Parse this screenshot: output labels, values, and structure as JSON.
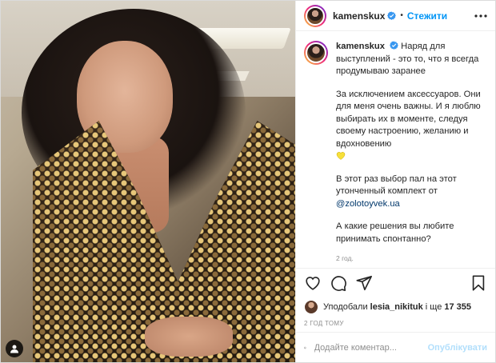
{
  "header": {
    "username": "kamenskux",
    "separator": "•",
    "follow_label": "Стежити"
  },
  "caption": {
    "username": "kamenskux",
    "p1": "Наряд для выступлений - это то, что я всегда продумываю заранее",
    "p2": "За исключением аксессуаров. Они для меня очень важны. И я люблю выбирать их в моменте, следуя своему настроению, желанию и вдохновению",
    "p3_before": "В этот раз выбор пал на этот утонченный комплект от",
    "p3_mention": "@zolotoyvek.ua",
    "p4": "А какие решения вы любите принимать спонтанно?",
    "time_ago": "2 год."
  },
  "likes": {
    "prefix": "Уподобали",
    "user": "lesia_nikituk",
    "middle": "і ще",
    "count": "17 355"
  },
  "posted_time": "2 ГОД ТОМУ",
  "comment": {
    "placeholder": "Додайте коментар...",
    "publish_label": "Опублікувати"
  },
  "colors": {
    "accent": "#0095f6",
    "publish_disabled": "#b2dffc",
    "muted": "#8e8e8e",
    "heart_emoji": "#f7e03a"
  },
  "icons": [
    "user-tag-icon",
    "verified-badge-icon",
    "more-options-icon",
    "like-heart-icon",
    "comment-icon",
    "share-icon",
    "bookmark-icon",
    "emoji-icon",
    "yellow-heart-emoji"
  ]
}
